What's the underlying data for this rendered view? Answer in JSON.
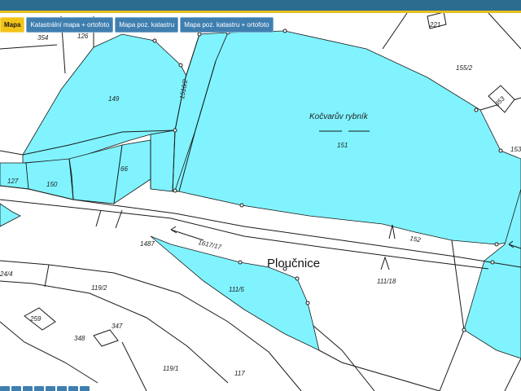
{
  "colors": {
    "header": "#2b6c8f",
    "header_stripe": "#e8c020",
    "parcel_fill": "#80f3ff",
    "line": "#1a1a1a",
    "tab_bg": "#3f7fb0",
    "tab_active_bg": "#f2c318"
  },
  "toolbar": {
    "tabs": [
      "Mapa",
      "Katastrální mapa + ortofoto",
      "Mapa poz. katastru",
      "Mapa poz. katastru + ortofoto"
    ],
    "active_index": 0
  },
  "map": {
    "pond_name": "Kočvarův rybník",
    "street_name": "Ploučnice",
    "parcels": [
      "354",
      "126",
      "221",
      "155/2",
      "353",
      "149",
      "1510/2",
      "151",
      "153",
      "127",
      "150",
      "66",
      "1487",
      "1617/17",
      "152",
      "24/4",
      "119/2",
      "111/5",
      "111/18",
      "259",
      "347",
      "348",
      "119/1",
      "117"
    ]
  }
}
